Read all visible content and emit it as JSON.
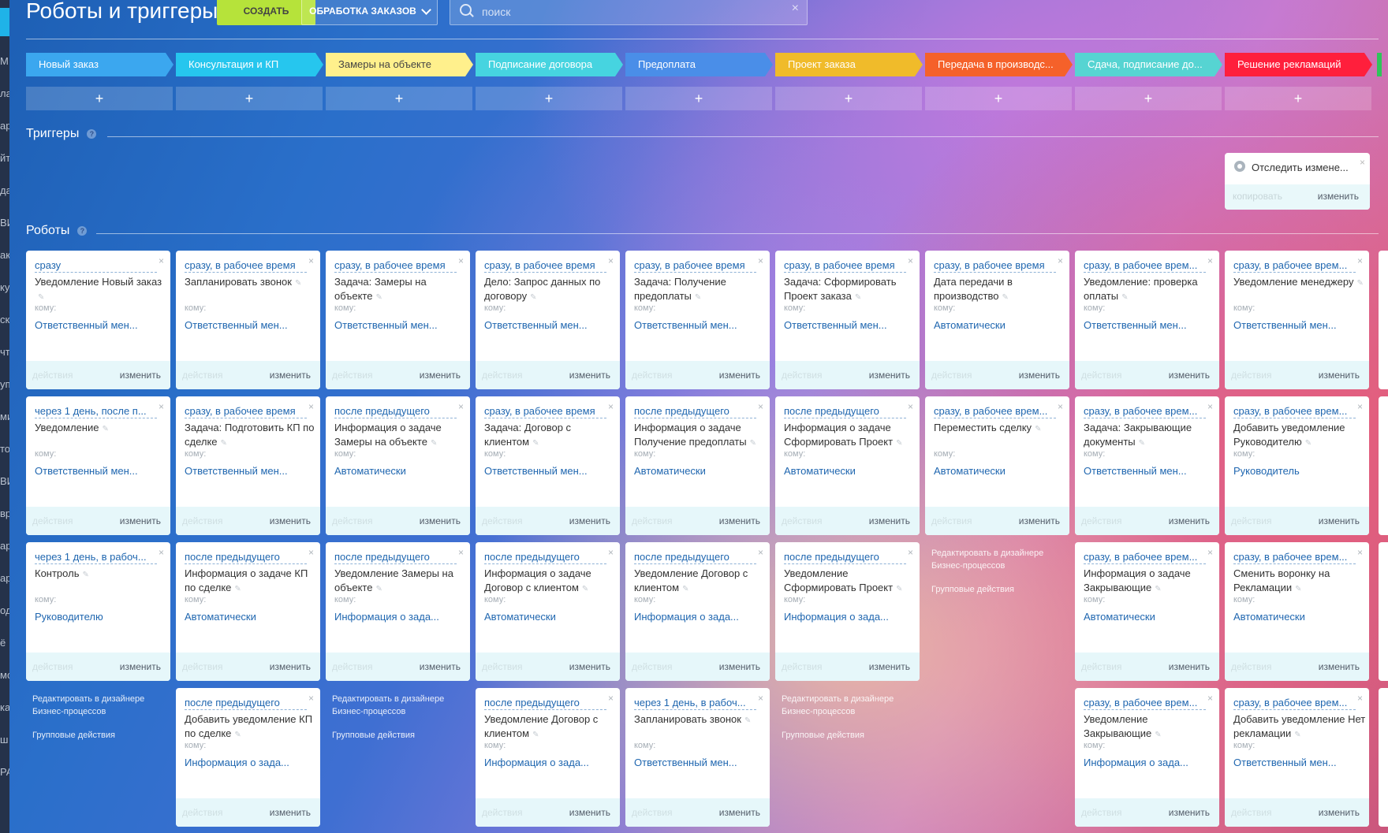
{
  "header": {
    "title": "Роботы и триггеры",
    "create_label": "СОЗДАТЬ",
    "pipeline_label": "ОБРАБОТКА ЗАКАЗОВ",
    "search_placeholder": "поиск"
  },
  "sidebar": {
    "fragments": [
      "М",
      "ла",
      "ар",
      "йт",
      "да",
      "ВИ",
      "ак",
      "ку",
      "ск",
      "чт",
      "уп",
      "ми",
      "то",
      "ВИ",
      "вр",
      "ар",
      "ар",
      "од",
      "ё",
      "мо",
      "ка",
      "ш",
      "РА"
    ]
  },
  "stages": [
    {
      "label": "Новый заказ",
      "color": "#3ba7ef",
      "text": "#ffffff"
    },
    {
      "label": "Консультация и КП",
      "color": "#26c6ee",
      "text": "#ffffff"
    },
    {
      "label": "Замеры на объекте",
      "color": "#fff08c",
      "text": "#444444"
    },
    {
      "label": "Подписание договора",
      "color": "#46d4e0",
      "text": "#ffffff"
    },
    {
      "label": "Предоплата",
      "color": "#4a8ee8",
      "text": "#ffffff"
    },
    {
      "label": "Проект заказа",
      "color": "#f0bb2a",
      "text": "#ffffff"
    },
    {
      "label": "Передача в производс...",
      "color": "#f5612a",
      "text": "#ffffff"
    },
    {
      "label": "Сдача, подписание до...",
      "color": "#56d4d2",
      "text": "#ffffff"
    },
    {
      "label": "Решение рекламаций",
      "color": "#ff1f3c",
      "text": "#ffffff"
    }
  ],
  "add_label": "+",
  "triggers": {
    "title": "Триггеры",
    "help": "?",
    "card": {
      "name": "Отследить измене...",
      "copy": "копировать",
      "edit": "изменить",
      "close": "×"
    }
  },
  "robots": {
    "title": "Роботы",
    "help": "?"
  },
  "card_labels": {
    "to": "кому:",
    "actions": "действия",
    "edit": "изменить",
    "close": "×",
    "pencil": "✎"
  },
  "column_footer": {
    "designer": "Редактировать в дизайнере Бизнес-процессов",
    "group": "Групповые действия"
  },
  "columns": [
    {
      "robots": [
        {
          "when": "сразу",
          "name": "Уведомление Новый заказ",
          "to": "Ответственный мен..."
        },
        {
          "when": "через 1 день, после п...",
          "name": "Уведомление",
          "to": "Ответственный мен..."
        },
        {
          "when": "через 1 день, в рабоч...",
          "name": "Контроль",
          "to": "Руководителю"
        }
      ],
      "footer": 3
    },
    {
      "robots": [
        {
          "when": "сразу, в рабочее время",
          "name": "Запланировать звонок",
          "to": "Ответственный мен..."
        },
        {
          "when": "сразу, в рабочее время",
          "name": "Задача: Подготовить КП по сделке",
          "to": "Ответственный мен..."
        },
        {
          "when": "после предыдущего",
          "name": "Информация о задаче КП по сделке",
          "to": "Автоматически"
        },
        {
          "when": "после предыдущего",
          "name": "Добавить уведомление КП по сделке",
          "to": "Информация о зада..."
        }
      ],
      "footer": null
    },
    {
      "robots": [
        {
          "when": "сразу, в рабочее время",
          "name": "Задача: Замеры на объекте",
          "to": "Ответственный мен..."
        },
        {
          "when": "после предыдущего",
          "name": "Информация о задаче Замеры на объекте",
          "to": "Автоматически"
        },
        {
          "when": "после предыдущего",
          "name": "Уведомление Замеры на объекте",
          "to": "Информация о зада..."
        }
      ],
      "footer": 3
    },
    {
      "robots": [
        {
          "when": "сразу, в рабочее время",
          "name": "Дело: Запрос данных по договору",
          "to": "Ответственный мен..."
        },
        {
          "when": "сразу, в рабочее время",
          "name": "Задача: Договор с клиентом",
          "to": "Ответственный мен..."
        },
        {
          "when": "после предыдущего",
          "name": "Информация о задаче Договор с клиентом",
          "to": "Автоматически"
        },
        {
          "when": "после предыдущего",
          "name": "Уведомление Договор с клиентом",
          "to": "Информация о зада..."
        }
      ],
      "footer": null
    },
    {
      "robots": [
        {
          "when": "сразу, в рабочее время",
          "name": "Задача: Получение предоплаты",
          "to": "Ответственный мен..."
        },
        {
          "when": "после предыдущего",
          "name": "Информация о задаче Получение предоплаты",
          "to": "Автоматически"
        },
        {
          "when": "после предыдущего",
          "name": "Уведомление Договор с клиентом",
          "to": "Информация о зада..."
        },
        {
          "when": "через 1 день, в рабоч...",
          "name": "Запланировать звонок",
          "to": "Ответственный мен..."
        }
      ],
      "footer": null
    },
    {
      "robots": [
        {
          "when": "сразу, в рабочее время",
          "name": "Задача: Сформировать Проект заказа",
          "to": "Ответственный мен..."
        },
        {
          "when": "после предыдущего",
          "name": "Информация о задаче Сформировать Проект",
          "to": "Автоматически"
        },
        {
          "when": "после предыдущего",
          "name": "Уведомление Сформировать Проект",
          "to": "Информация о зада..."
        }
      ],
      "footer": 3
    },
    {
      "robots": [
        {
          "when": "сразу, в рабочее время",
          "name": "Дата передачи в производство",
          "to": "Автоматически"
        },
        {
          "when": "сразу, в рабочее врем...",
          "name": "Переместить сделку",
          "to": "Автоматически"
        }
      ],
      "footer": 2
    },
    {
      "robots": [
        {
          "when": "сразу, в рабочее врем...",
          "name": "Уведомление: проверка оплаты",
          "to": "Ответственный мен..."
        },
        {
          "when": "сразу, в рабочее врем...",
          "name": "Задача: Закрывающие документы",
          "to": "Ответственный мен..."
        },
        {
          "when": "сразу, в рабочее врем...",
          "name": "Информация о задаче Закрывающие",
          "to": "Автоматически"
        },
        {
          "when": "сразу, в рабочее врем...",
          "name": "Уведомление Закрывающие",
          "to": "Информация о зада..."
        }
      ],
      "footer": null
    },
    {
      "robots": [
        {
          "when": "сразу, в рабочее врем...",
          "name": "Уведомление менеджеру",
          "to": "Ответственный мен..."
        },
        {
          "when": "сразу, в рабочее врем...",
          "name": "Добавить уведомление Руководителю",
          "to": "Руководитель"
        },
        {
          "when": "сразу, в рабочее врем...",
          "name": "Сменить воронку на Рекламации",
          "to": "Автоматически"
        },
        {
          "when": "сразу, в рабочее врем...",
          "name": "Добавить уведомление Нет рекламации",
          "to": "Ответственный мен..."
        }
      ],
      "footer": null
    }
  ]
}
